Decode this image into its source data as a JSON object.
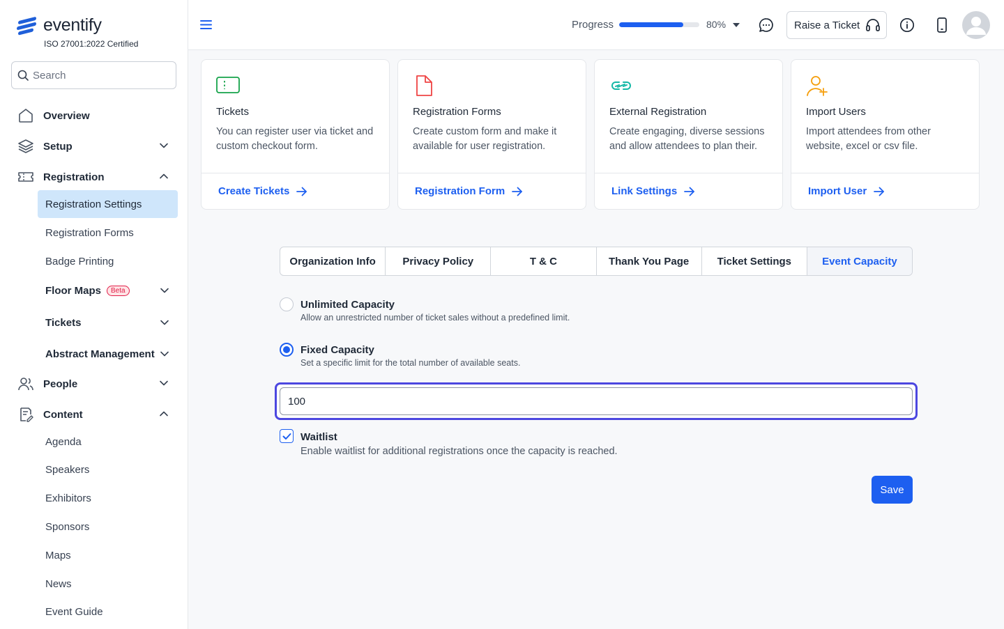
{
  "brand": {
    "name": "eventify",
    "certification": "ISO 27001:2022 Certified",
    "accent": "#1d5ff0"
  },
  "search": {
    "placeholder": "Search"
  },
  "sidebar": {
    "overview": "Overview",
    "setup": "Setup",
    "registration": "Registration",
    "registration_items": [
      "Registration Settings",
      "Registration Forms",
      "Badge Printing"
    ],
    "floor_maps": "Floor Maps",
    "beta": "Beta",
    "tickets": "Tickets",
    "abstract": "Abstract Management",
    "people": "People",
    "content": "Content",
    "content_items": [
      "Agenda",
      "Speakers",
      "Exhibitors",
      "Sponsors",
      "Maps",
      "News",
      "Event Guide"
    ]
  },
  "header": {
    "progress_label": "Progress",
    "progress_value": 80,
    "progress_text": "80%",
    "raise_ticket": "Raise a Ticket"
  },
  "cards": [
    {
      "title": "Tickets",
      "desc": "You can register user via ticket and custom checkout form.",
      "link": "Create Tickets",
      "icon": "ticket-icon"
    },
    {
      "title": "Registration Forms",
      "desc": "Create custom form and make it available for user registration.",
      "link": "Registration Form",
      "icon": "file-icon"
    },
    {
      "title": "External Registration",
      "desc": "Create engaging, diverse sessions and allow attendees to plan their.",
      "link": "Link Settings",
      "icon": "link-icon"
    },
    {
      "title": "Import Users",
      "desc": "Import attendees from other website, excel or csv file.",
      "link": "Import User",
      "icon": "user-plus-icon"
    }
  ],
  "tabs": [
    "Organization Info",
    "Privacy Policy",
    "T & C",
    "Thank You Page",
    "Ticket Settings",
    "Event Capacity"
  ],
  "active_tab": "Event Capacity",
  "capacity": {
    "unlimited_title": "Unlimited Capacity",
    "unlimited_desc": "Allow an unrestricted number of ticket sales without a predefined limit.",
    "fixed_title": "Fixed Capacity",
    "fixed_desc": "Set a specific limit for the total number of available seats.",
    "selected": "fixed",
    "value": "100",
    "waitlist_title": "Waitlist",
    "waitlist_desc": "Enable waitlist for additional registrations once the capacity is reached.",
    "waitlist_checked": true,
    "save": "Save"
  }
}
